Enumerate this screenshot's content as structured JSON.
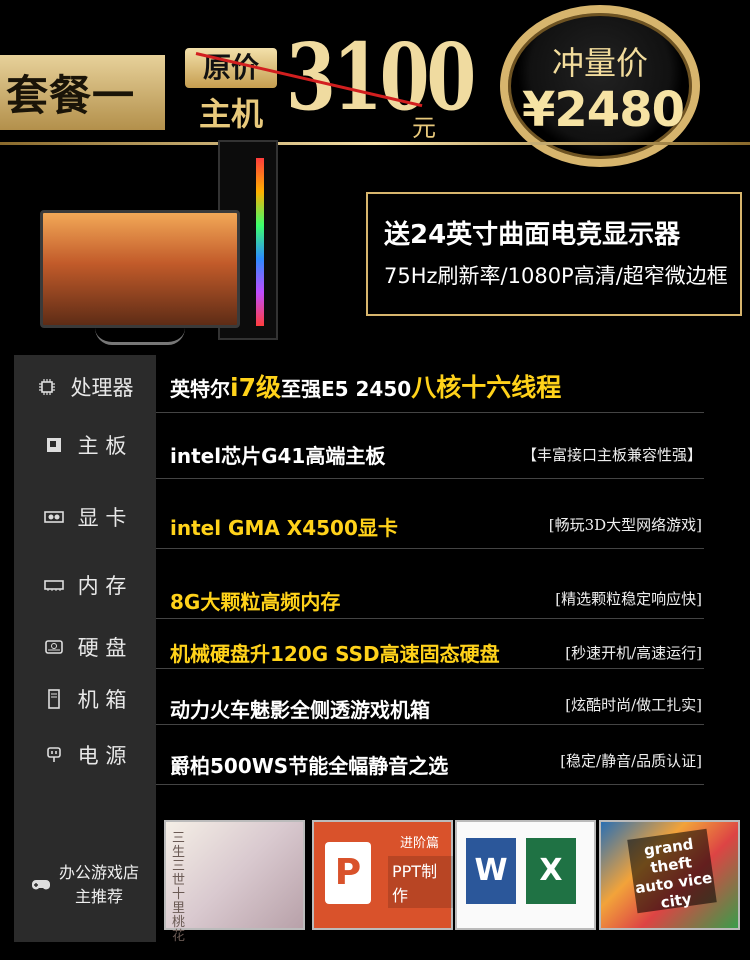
{
  "header": {
    "package_title": "套餐一",
    "orig_label": "原价",
    "host_label": "主机",
    "orig_price": "3100",
    "orig_unit": "元",
    "promo_label": "冲量价",
    "promo_price": "¥2480"
  },
  "gift": {
    "title": "送24英寸曲面电竞显示器",
    "desc": "75Hz刷新率/1080P高清/超窄微边框"
  },
  "specs": [
    {
      "label": "处理器",
      "icon": "cpu-icon",
      "value_a": "英特尔",
      "value_b": "i7级",
      "value_c": "至强E5 2450",
      "value_d": "八核十六线程",
      "note": ""
    },
    {
      "label": "主 板",
      "icon": "motherboard-icon",
      "value": "intel芯片G41高端主板",
      "note": "【丰富接口主板兼容性强】"
    },
    {
      "label": "显 卡",
      "icon": "gpu-icon",
      "value": "intel GMA X4500显卡",
      "note": "[畅玩3D大型网络游戏]"
    },
    {
      "label": "内 存",
      "icon": "memory-icon",
      "value": "8G大颗粒高频内存",
      "note": "[精选颗粒稳定响应快]"
    },
    {
      "label": "硬 盘",
      "icon": "hdd-icon",
      "value": "机械硬盘升120G SSD高速固态硬盘",
      "note": "[秒速开机/高速运行]"
    },
    {
      "label": "机 箱",
      "icon": "case-icon",
      "value": "动力火车魅影全侧透游戏机箱",
      "note": "[炫酷时尚/做工扎实]"
    },
    {
      "label": "电 源",
      "icon": "power-icon",
      "value": "爵柏500WS节能全幅静音之选",
      "note": "[稳定/静音/品质认证]"
    }
  ],
  "recommend": {
    "label": "办公游戏店主推荐",
    "icon": "gamepad-icon",
    "ppt_badge": "进阶篇",
    "ppt_text": "PPT制作",
    "word_letter": "W",
    "excel_letter": "X",
    "gta_text": "grand theft auto vice city",
    "drama_text": "三生三世十里桃花"
  },
  "colors": {
    "gold": "#d7b56d",
    "highlight": "#ffd21a",
    "panel": "#2b2b2b",
    "strike": "#d21f1f"
  }
}
